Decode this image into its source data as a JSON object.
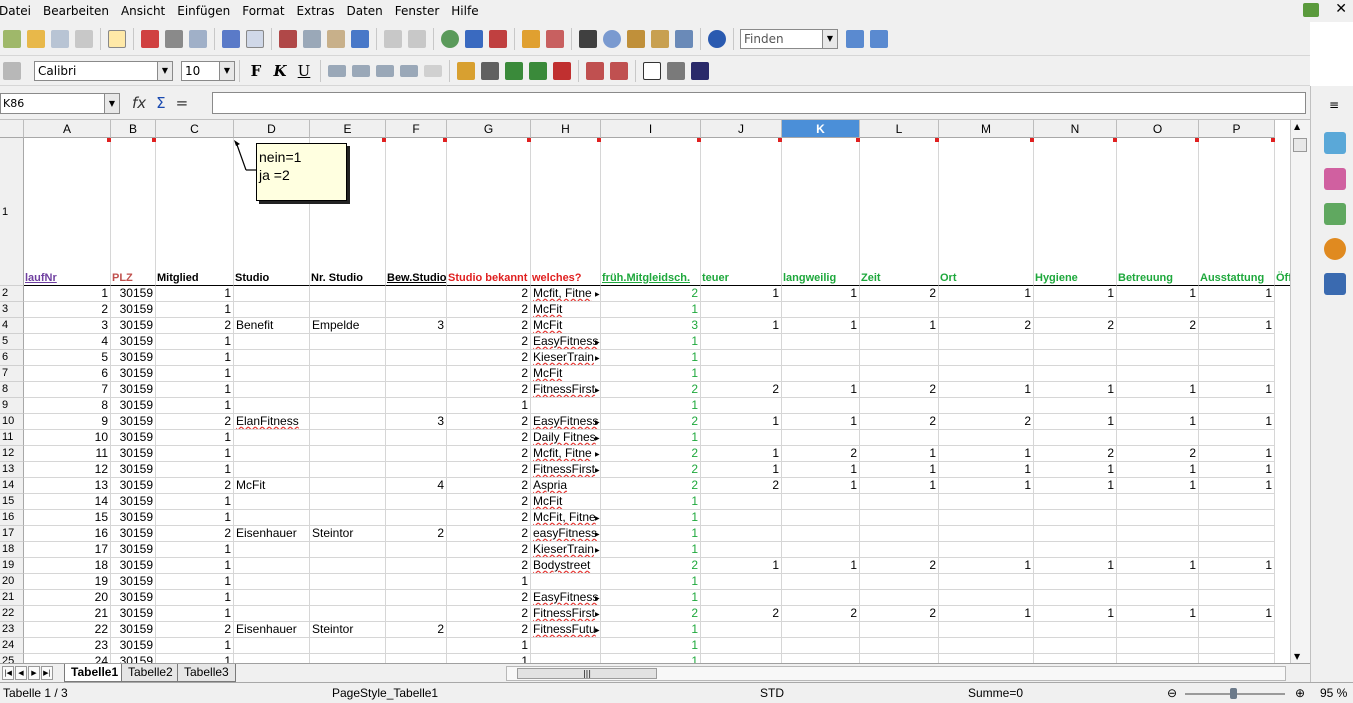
{
  "menu": [
    "Datei",
    "Bearbeiten",
    "Ansicht",
    "Einfügen",
    "Format",
    "Extras",
    "Daten",
    "Fenster",
    "Hilfe"
  ],
  "toolbar": {
    "find_placeholder": "Finden",
    "font_name": "Calibri",
    "font_size": "10"
  },
  "formula_bar": {
    "cell_ref": "K86",
    "formula": ""
  },
  "columns": [
    "A",
    "B",
    "C",
    "D",
    "E",
    "F",
    "G",
    "H",
    "I",
    "J",
    "K",
    "L",
    "M",
    "N",
    "O",
    "P"
  ],
  "selected_column": "K",
  "header_row": [
    "laufNr",
    "PLZ",
    "Mitglied",
    "Studio",
    "Nr. Studio",
    "Bew.Studio",
    "Studio bekannt",
    "welches?",
    "früh.Mitgleidsch.",
    "teuer",
    "langweilig",
    "Zeit",
    "Ort",
    "Hygiene",
    "Betreuung",
    "Ausstattung",
    "Öff"
  ],
  "header_colors": [
    "#6f3fa0",
    "#c0504d",
    "#000000",
    "#000000",
    "#000000",
    "#000000",
    "#e02020",
    "#e02020",
    "#1ea83c",
    "#1ea83c",
    "#1ea83c",
    "#1ea83c",
    "#1ea83c",
    "#1ea83c",
    "#1ea83c",
    "#1ea83c",
    "#1ea83c"
  ],
  "note": {
    "line1": "nein=1",
    "line2": "ja =2"
  },
  "rows": [
    [
      "1",
      "30159",
      "1",
      "",
      "",
      "",
      "2",
      "Mcfit, Fitne",
      "2",
      "1",
      "1",
      "2",
      "1",
      "1",
      "1",
      "1"
    ],
    [
      "2",
      "30159",
      "1",
      "",
      "",
      "",
      "2",
      "McFit",
      "1",
      "",
      "",
      "",
      "",
      "",
      "",
      ""
    ],
    [
      "3",
      "30159",
      "2",
      "Benefit",
      "Empelde",
      "3",
      "2",
      "McFit",
      "3",
      "1",
      "1",
      "1",
      "2",
      "2",
      "2",
      "1"
    ],
    [
      "4",
      "30159",
      "1",
      "",
      "",
      "",
      "2",
      "EasyFitness",
      "1",
      "",
      "",
      "",
      "",
      "",
      "",
      ""
    ],
    [
      "5",
      "30159",
      "1",
      "",
      "",
      "",
      "2",
      "KieserTrain",
      "1",
      "",
      "",
      "",
      "",
      "",
      "",
      ""
    ],
    [
      "6",
      "30159",
      "1",
      "",
      "",
      "",
      "2",
      "McFit",
      "1",
      "",
      "",
      "",
      "",
      "",
      "",
      ""
    ],
    [
      "7",
      "30159",
      "1",
      "",
      "",
      "",
      "2",
      "FitnessFirst",
      "2",
      "2",
      "1",
      "2",
      "1",
      "1",
      "1",
      "1"
    ],
    [
      "8",
      "30159",
      "1",
      "",
      "",
      "",
      "1",
      "",
      "1",
      "",
      "",
      "",
      "",
      "",
      "",
      ""
    ],
    [
      "9",
      "30159",
      "2",
      "ElanFitness",
      "",
      "3",
      "2",
      "EasyFitness",
      "2",
      "1",
      "1",
      "2",
      "2",
      "1",
      "1",
      "1"
    ],
    [
      "10",
      "30159",
      "1",
      "",
      "",
      "",
      "2",
      "Daily Fitnes",
      "1",
      "",
      "",
      "",
      "",
      "",
      "",
      ""
    ],
    [
      "11",
      "30159",
      "1",
      "",
      "",
      "",
      "2",
      "Mcfit, Fitne",
      "2",
      "1",
      "2",
      "1",
      "1",
      "2",
      "2",
      "1"
    ],
    [
      "12",
      "30159",
      "1",
      "",
      "",
      "",
      "2",
      "FitnessFirst",
      "2",
      "1",
      "1",
      "1",
      "1",
      "1",
      "1",
      "1"
    ],
    [
      "13",
      "30159",
      "2",
      "McFit",
      "",
      "4",
      "2",
      "Aspria",
      "2",
      "2",
      "1",
      "1",
      "1",
      "1",
      "1",
      "1"
    ],
    [
      "14",
      "30159",
      "1",
      "",
      "",
      "",
      "2",
      "McFit",
      "1",
      "",
      "",
      "",
      "",
      "",
      "",
      ""
    ],
    [
      "15",
      "30159",
      "1",
      "",
      "",
      "",
      "2",
      "McFit, Fitne",
      "1",
      "",
      "",
      "",
      "",
      "",
      "",
      ""
    ],
    [
      "16",
      "30159",
      "2",
      "Eisenhauer",
      "Steintor",
      "2",
      "2",
      "easyFitness",
      "1",
      "",
      "",
      "",
      "",
      "",
      "",
      ""
    ],
    [
      "17",
      "30159",
      "1",
      "",
      "",
      "",
      "2",
      "KieserTrain",
      "1",
      "",
      "",
      "",
      "",
      "",
      "",
      ""
    ],
    [
      "18",
      "30159",
      "1",
      "",
      "",
      "",
      "2",
      "Bodystreet",
      "2",
      "1",
      "1",
      "2",
      "1",
      "1",
      "1",
      "1"
    ],
    [
      "19",
      "30159",
      "1",
      "",
      "",
      "",
      "1",
      "",
      "1",
      "",
      "",
      "",
      "",
      "",
      "",
      ""
    ],
    [
      "20",
      "30159",
      "1",
      "",
      "",
      "",
      "2",
      "EasyFitness",
      "1",
      "",
      "",
      "",
      "",
      "",
      "",
      ""
    ],
    [
      "21",
      "30159",
      "1",
      "",
      "",
      "",
      "2",
      "FitnessFirst",
      "2",
      "2",
      "2",
      "2",
      "1",
      "1",
      "1",
      "1"
    ],
    [
      "22",
      "30159",
      "2",
      "Eisenhauer",
      "Steintor",
      "2",
      "2",
      "FitnessFutu",
      "1",
      "",
      "",
      "",
      "",
      "",
      "",
      ""
    ],
    [
      "23",
      "30159",
      "1",
      "",
      "",
      "",
      "1",
      "",
      "1",
      "",
      "",
      "",
      "",
      "",
      "",
      ""
    ],
    [
      "24",
      "30159",
      "1",
      "",
      "",
      "",
      "1",
      "",
      "1",
      "",
      "",
      "",
      "",
      "",
      "",
      ""
    ]
  ],
  "row_numbers": [
    "1",
    "2",
    "3",
    "4",
    "5",
    "6",
    "7",
    "8",
    "9",
    "10",
    "11",
    "12",
    "13",
    "14",
    "15",
    "16",
    "17",
    "18",
    "19",
    "20",
    "21",
    "22",
    "23",
    "24",
    "25"
  ],
  "sheet_tabs": [
    "Tabelle1",
    "Tabelle2",
    "Tabelle3"
  ],
  "status": {
    "sheet": "Tabelle 1 / 3",
    "page_style": "PageStyle_Tabelle1",
    "mode": "STD",
    "sum": "Summe=0",
    "zoom": "95 %"
  }
}
